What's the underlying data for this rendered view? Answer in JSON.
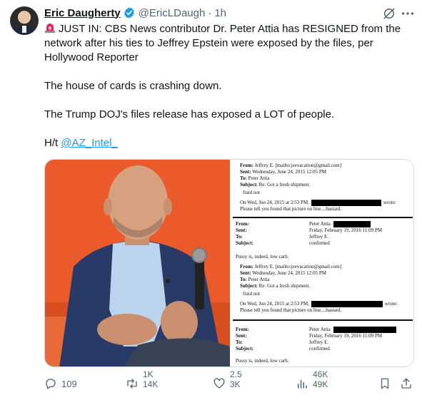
{
  "author": {
    "name": "Eric Daugherty",
    "handle": "@EricLDaugh",
    "separator": "·",
    "time": "1h"
  },
  "tweet": {
    "line1": "JUST IN: CBS News contributor Dr. Peter Attia has RESIGNED from the network after his ties to Jeffrey Epstein were exposed by the files, per Hollywood Reporter",
    "line2": "The house of cards is crashing down.",
    "line3": "The Trump DOJ's files release has exposed a LOT of people.",
    "hat_tip_prefix": "H/t",
    "mention": "@AZ_Intel_"
  },
  "document": {
    "email1": {
      "from_label": "From:",
      "from_value": "Jeffrey E. [mailto:jeevacation@gmail.com]",
      "sent_label": "Sent:",
      "sent_value": "Wednesday, June 24, 2015 12:05 PM",
      "to_label": "To:",
      "to_value": "Peter Attia",
      "subject_label": "Subject:",
      "subject_value": "Re: Got a fresh shipment.",
      "body": "fraid not",
      "quote_prefix": "On Wed, Jun 24, 2015 at 2:53 PM,",
      "quote_suffix": "wrote:",
      "quote_line2": "Please tell you found that picture on line....bastard."
    },
    "email2": {
      "from_label": "From:",
      "from_value": "Peter Attia",
      "sent_label": "Sent:",
      "sent_value": "Friday, February 19, 2016 11:09 PM",
      "to_label": "To:",
      "to_value": "Jeffrey E.",
      "subject_label": "Subject:",
      "subject_value": "confirmed",
      "body": "Pussy is, indeed, low carb."
    }
  },
  "actions": {
    "replies": "109",
    "reposts_top": "1K",
    "reposts_bottom": "14K",
    "likes_top": "2.5",
    "likes_bottom": "3K",
    "views_top": "46K",
    "views_bottom": "49K"
  },
  "colors": {
    "accent": "#1d9bf0",
    "muted": "#536471",
    "photo_background": "#ea5a2a"
  },
  "icons": [
    "verified-badge-icon",
    "grok-icon",
    "more-icon",
    "siren-icon",
    "reply-icon",
    "repost-icon",
    "like-icon",
    "views-icon",
    "bookmark-icon",
    "share-icon"
  ]
}
